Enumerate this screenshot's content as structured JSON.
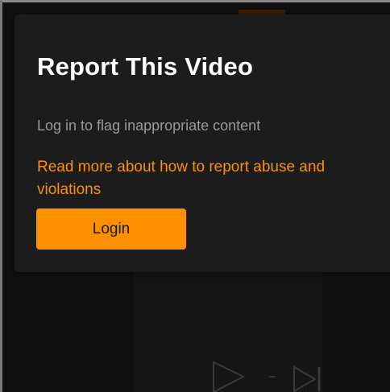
{
  "modal": {
    "title": "Report This Video",
    "subtitle": "Log in to flag inappropriate content",
    "link_text": "Read more about how to report abuse and violations",
    "login_label": "Login"
  },
  "colors": {
    "accent": "#ff9000",
    "modal_background": "#1c1c1c",
    "page_background": "#101010",
    "subtitle_text": "#9a9a9a"
  },
  "icons": {
    "play": "play-icon",
    "skip_next": "skip-next-icon"
  }
}
